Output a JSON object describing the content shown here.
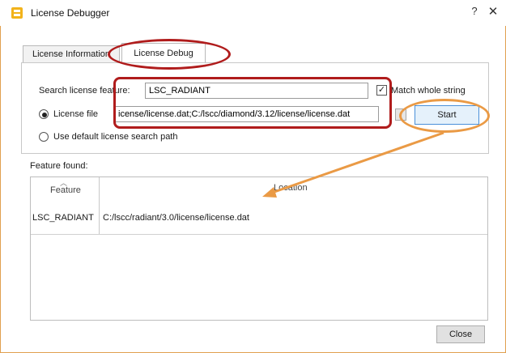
{
  "window": {
    "title": "License Debugger",
    "help_glyph": "?",
    "close_glyph": "✕",
    "icon": "app-icon",
    "accent": "#ea9a45"
  },
  "tabs": [
    {
      "label": "License Information",
      "active": false
    },
    {
      "label": "License Debug",
      "active": true
    }
  ],
  "form": {
    "search_label": "Search license feature:",
    "search_value": "LSC_RADIANT",
    "match_whole_label": "Match whole string",
    "match_whole_checked": true,
    "license_file_label": "License file",
    "license_file_selected": true,
    "license_file_value": "icense/license.dat;C:/lscc/diamond/3.12/license/license.dat",
    "default_path_label": "Use default license search path",
    "start_label": "Start"
  },
  "results": {
    "section_label": "Feature found:",
    "columns": [
      "Feature",
      "Location"
    ],
    "rows": [
      {
        "feature": "LSC_RADIANT",
        "location": "C:/lscc/radiant/3.0/license/license.dat"
      }
    ]
  },
  "footer": {
    "close_label": "Close"
  },
  "annotation_colors": {
    "red": "#b01c1c",
    "orange": "#ea9a45"
  }
}
